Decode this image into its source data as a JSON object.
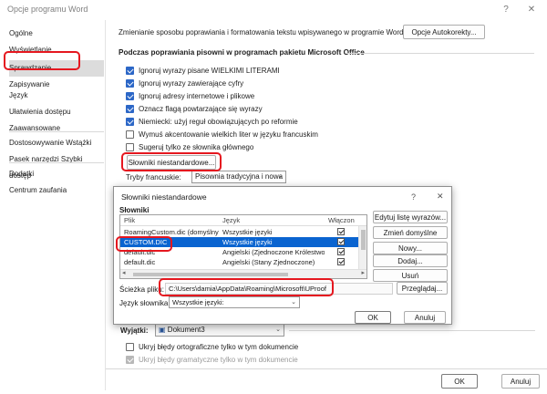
{
  "window": {
    "title": "Opcje programu Word",
    "help": "?",
    "close": "✕"
  },
  "sidebar": {
    "items": [
      {
        "label": "Ogólne"
      },
      {
        "label": "Wyświetlanie"
      },
      {
        "label": "Sprawdzanie"
      },
      {
        "label": "Zapisywanie"
      },
      {
        "label": "Język"
      },
      {
        "label": "Ułatwienia dostępu"
      },
      {
        "label": "Zaawansowane"
      },
      {
        "label": "Dostosowywanie Wstążki"
      },
      {
        "label": "Pasek narzędzi Szybki dostęp"
      },
      {
        "label": "Dodatki"
      },
      {
        "label": "Centrum zaufania"
      }
    ],
    "selected": "Sprawdzanie"
  },
  "main": {
    "autocorrect_text": "Zmienianie sposobu poprawiania i formatowania tekstu wpisywanego w programie Word:",
    "autocorrect_button": "Opcje Autokorekty...",
    "section_title": "Podczas poprawiania pisowni w programach pakietu Microsoft Office",
    "options": [
      {
        "label": "Ignoruj wyrazy pisane WIELKIMI LITERAMI",
        "checked": true
      },
      {
        "label": "Ignoruj wyrazy zawierające cyfry",
        "checked": true
      },
      {
        "label": "Ignoruj adresy internetowe i plikowe",
        "checked": true
      },
      {
        "label": "Oznacz flagą powtarzające się wyrazy",
        "checked": true
      },
      {
        "label": "Niemiecki: użyj reguł obowiązujących po reformie",
        "checked": true
      },
      {
        "label": "Wymuś akcentowanie wielkich liter w języku francuskim",
        "checked": false
      },
      {
        "label": "Sugeruj tylko ze słownika głównego",
        "checked": false
      }
    ],
    "custom_dict_button": "Słowniki niestandardowe...",
    "french_modes_label": "Tryby francuskie:",
    "french_modes_value": "Pisownia tradycyjna i nowa",
    "exceptions_label": "Wyjątki:",
    "exceptions_value": "Dokument3",
    "hide_spelling": "Ukryj błędy ortograficzne tylko w tym dokumencie",
    "hide_grammar": "Ukryj błędy gramatyczne tylko w tym dokumencie",
    "ok": "OK",
    "cancel": "Anuluj"
  },
  "dialog": {
    "title": "Słowniki niestandardowe",
    "help": "?",
    "close": "✕",
    "group_label": "Słowniki",
    "columns": {
      "file": "Plik",
      "language": "Język",
      "enabled": "Włączon"
    },
    "rows": [
      {
        "file": "RoamingCustom.dic (domyślny)",
        "language": "Wszystkie języki",
        "enabled": true
      },
      {
        "file": "CUSTOM.DIC",
        "language": "Wszystkie języki",
        "enabled": true
      },
      {
        "file": "default.dic",
        "language": "Angielski (Zjednoczone Królestwo)",
        "enabled": true
      },
      {
        "file": "default.dic",
        "language": "Angielski (Stany Zjednoczone)",
        "enabled": true
      }
    ],
    "selected_row": 1,
    "buttons": {
      "edit": "Edytuj listę wyrazów...",
      "default": "Zmień domyślne",
      "new": "Nowy...",
      "add": "Dodaj...",
      "remove": "Usuń",
      "browse": "Przeglądaj...",
      "ok": "OK",
      "cancel": "Anuluj"
    },
    "path_label": "Ścieżka pliku:",
    "path_value": "C:\\Users\\damia\\AppData\\Roaming\\Microsoft\\UProof",
    "lang_label": "Język słownika:",
    "lang_value": "Wszystkie języki:"
  },
  "colors": {
    "highlight": "#e5171f",
    "selection": "#0a64d0",
    "checkbox": "#2c67c7"
  }
}
